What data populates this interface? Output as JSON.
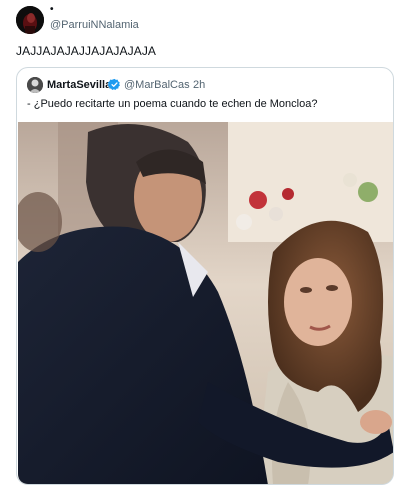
{
  "tweet": {
    "author_name": "•",
    "author_handle": "@ParruiNNalamia",
    "text": "JAJJAJAJAJJAJAJAJAJA"
  },
  "quoted": {
    "author_name": "MartaSevilla",
    "verified": true,
    "author_handle": "@MarBalCas",
    "separator": "·",
    "time": "2h",
    "text": "- ¿Puedo recitarte un poema cuando te echen de Moncloa?"
  },
  "colors": {
    "verified_blue": "#1d9bf0",
    "secondary_text": "#536471",
    "border": "#cfd9de"
  },
  "icons": {
    "verified": "verified-badge-icon"
  }
}
